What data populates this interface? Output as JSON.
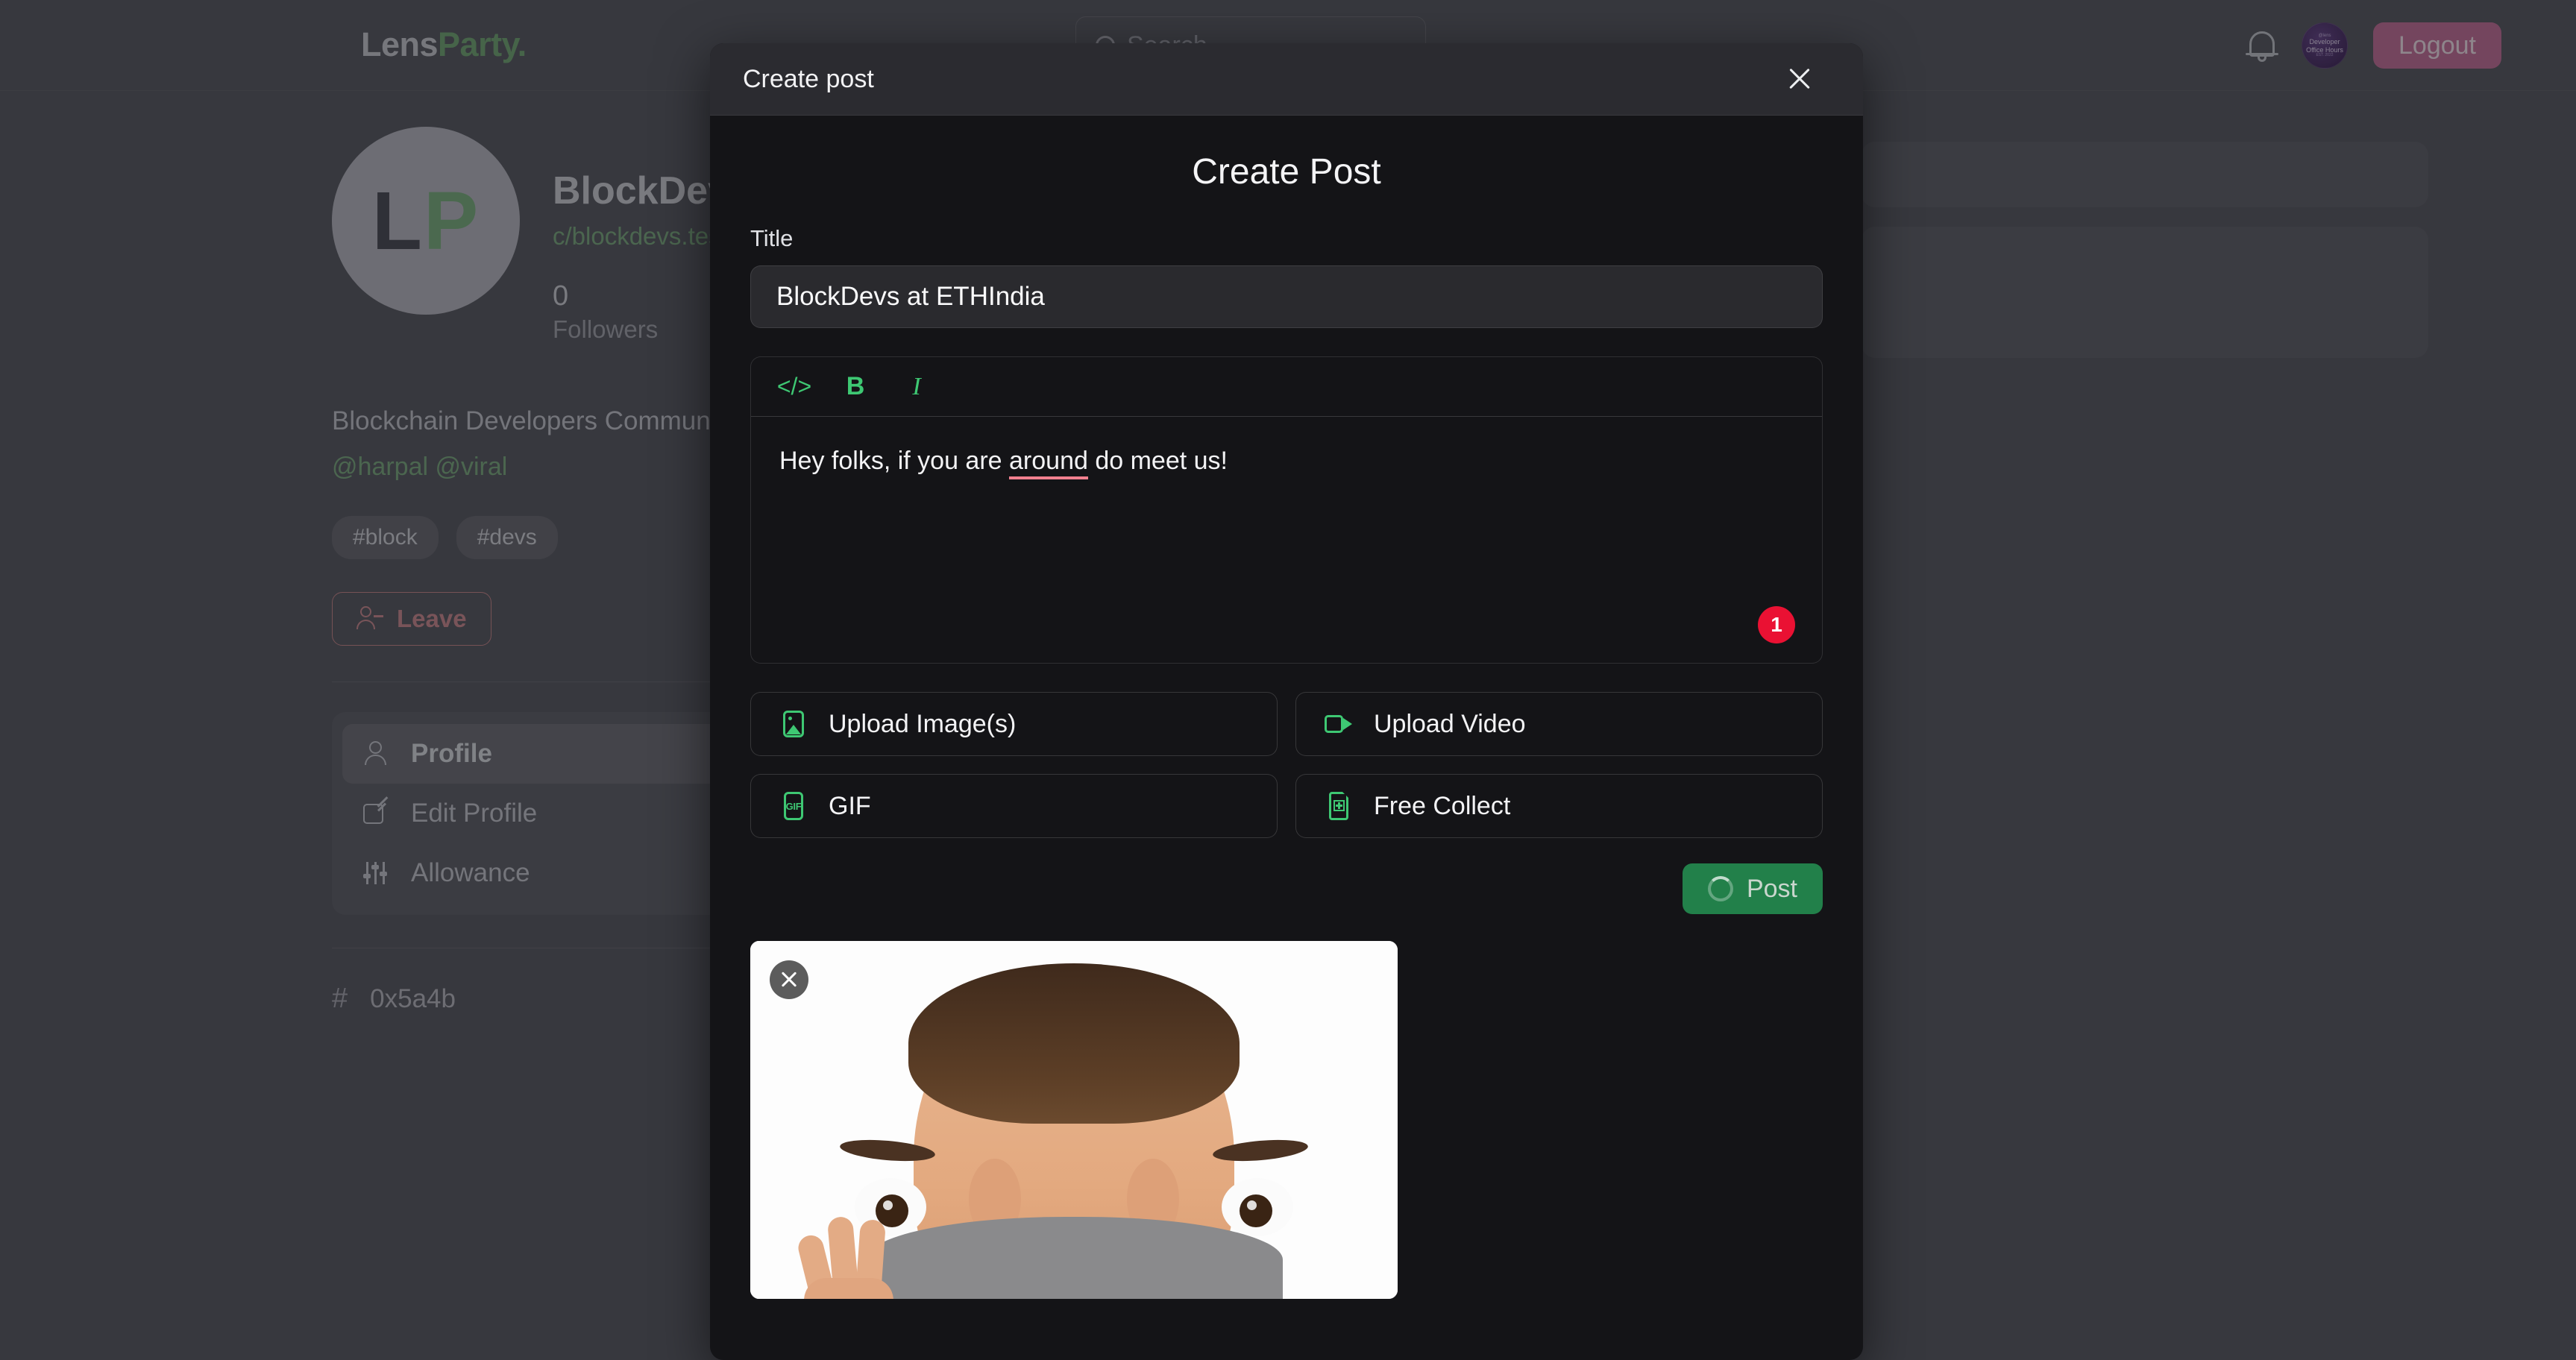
{
  "app": {
    "logo_primary": "Lens",
    "logo_accent": "Party.",
    "search_placeholder": "Search",
    "logout_label": "Logout",
    "avatar_top": "@lens",
    "avatar_mid": "Developer Office Hours",
    "avatar_bottom": "EST. 2022"
  },
  "profile": {
    "avatar_initial_1": "L",
    "avatar_initial_2": "P",
    "name": "BlockDevs",
    "handle": "c/blockdevs.test",
    "followers_count": "0",
    "followers_label": "Followers",
    "description": "Blockchain Developers Community",
    "moderators": "@harpal @viral",
    "tags": [
      "#block",
      "#devs"
    ],
    "leave_label": "Leave",
    "address": "0x5a4b",
    "hash_symbol": "#",
    "nav_items": [
      {
        "label": "Profile",
        "icon": "user-icon",
        "active": true
      },
      {
        "label": "Edit Profile",
        "icon": "edit-icon",
        "active": false
      },
      {
        "label": "Allowance",
        "icon": "sliders-icon",
        "active": false
      }
    ]
  },
  "modal": {
    "header_title": "Create post",
    "title_heading": "Create Post",
    "title_field_label": "Title",
    "title_field_value": "BlockDevs at ETHIndia",
    "toolbar": {
      "code_label": "</>",
      "bold_label": "B",
      "italic_label": "I"
    },
    "editor": {
      "text_before": "Hey folks, if you are ",
      "misspelled_word": "around",
      "text_after": " do meet us!",
      "badge_count": "1"
    },
    "actions": [
      {
        "label": "Upload Image(s)",
        "icon": "image-icon"
      },
      {
        "label": "Upload Video",
        "icon": "video-icon"
      },
      {
        "label": "GIF",
        "icon": "gif-icon"
      },
      {
        "label": "Free Collect",
        "icon": "collect-icon"
      }
    ],
    "post_label": "Post",
    "gif_icon_text": "GIF"
  },
  "colors": {
    "accent_green": "#3ec873",
    "badge_red": "#ea1133",
    "logout_pink": "#c7749e",
    "leave_red": "#cf8f95",
    "modal_bg": "#141417",
    "modal_header_bg": "#2b2b30",
    "page_bg": "#5c5d66"
  }
}
